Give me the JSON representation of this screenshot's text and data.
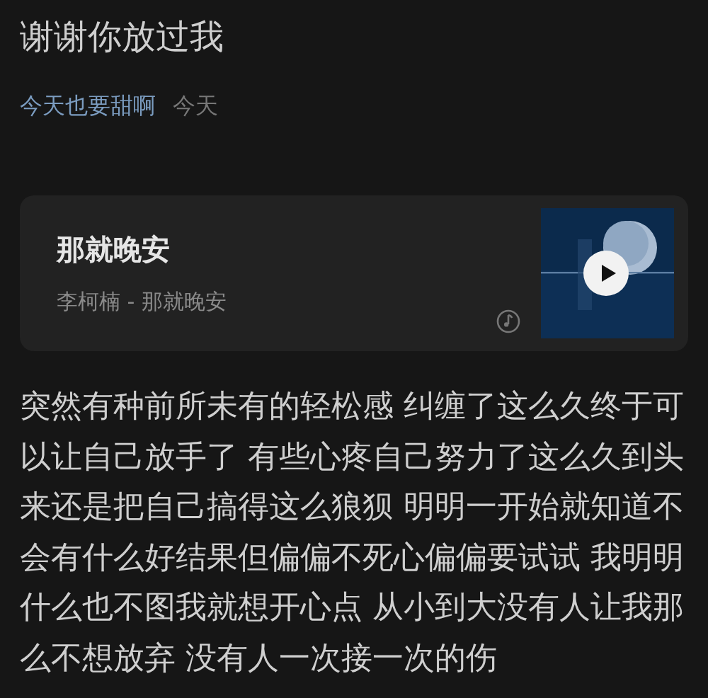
{
  "post": {
    "title": "谢谢你放过我",
    "author": "今天也要甜啊",
    "time": "今天"
  },
  "song_card": {
    "title": "那就晚安",
    "subtitle": "李柯楠 - 那就晚安"
  },
  "body": "突然有种前所未有的轻松感 纠缠了这么久终于可以让自己放手了 有些心疼自己努力了这么久到头来还是把自己搞得这么狼狈 明明一开始就知道不会有什么好结果但偏偏不死心偏偏要试试 我明明什么也不图我就想开心点 从小到大没有人让我那么不想放弃 没有人一次接一次的伤"
}
